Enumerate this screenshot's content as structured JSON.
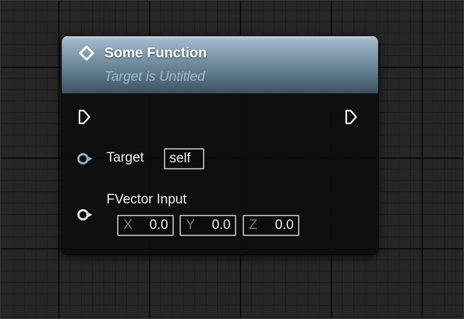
{
  "node": {
    "title": "Some Function",
    "subtitle": "Target is Untitled",
    "header_color": "#6a8396"
  },
  "pins": {
    "exec_in_icon": "exec-arrow-icon",
    "exec_out_icon": "exec-arrow-icon",
    "target": {
      "label": "Target",
      "value": "self"
    },
    "vector": {
      "label": "FVector Input",
      "x_axis": "X",
      "x_value": "0.0",
      "y_axis": "Y",
      "y_value": "0.0",
      "z_axis": "Z",
      "z_value": "0.0"
    }
  }
}
